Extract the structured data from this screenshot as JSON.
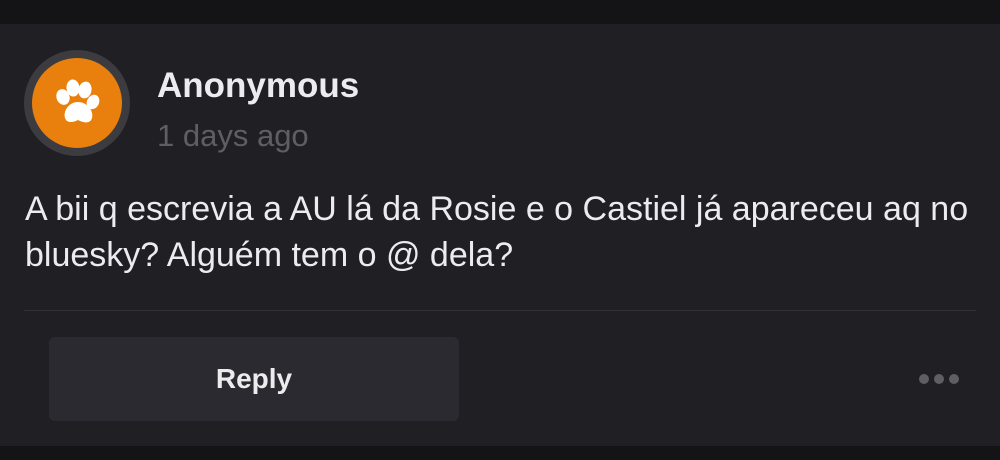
{
  "post": {
    "author": "Anonymous",
    "timestamp": "1 days ago",
    "avatar_icon": "paw-icon",
    "avatar_color": "#e9800e",
    "body": "A bii q escrevia a AU lá da Rosie e o Castiel já apareceu aq no bluesky? Alguém tem o @ dela?"
  },
  "actions": {
    "reply_label": "Reply",
    "more_icon": "more-horizontal-icon"
  }
}
